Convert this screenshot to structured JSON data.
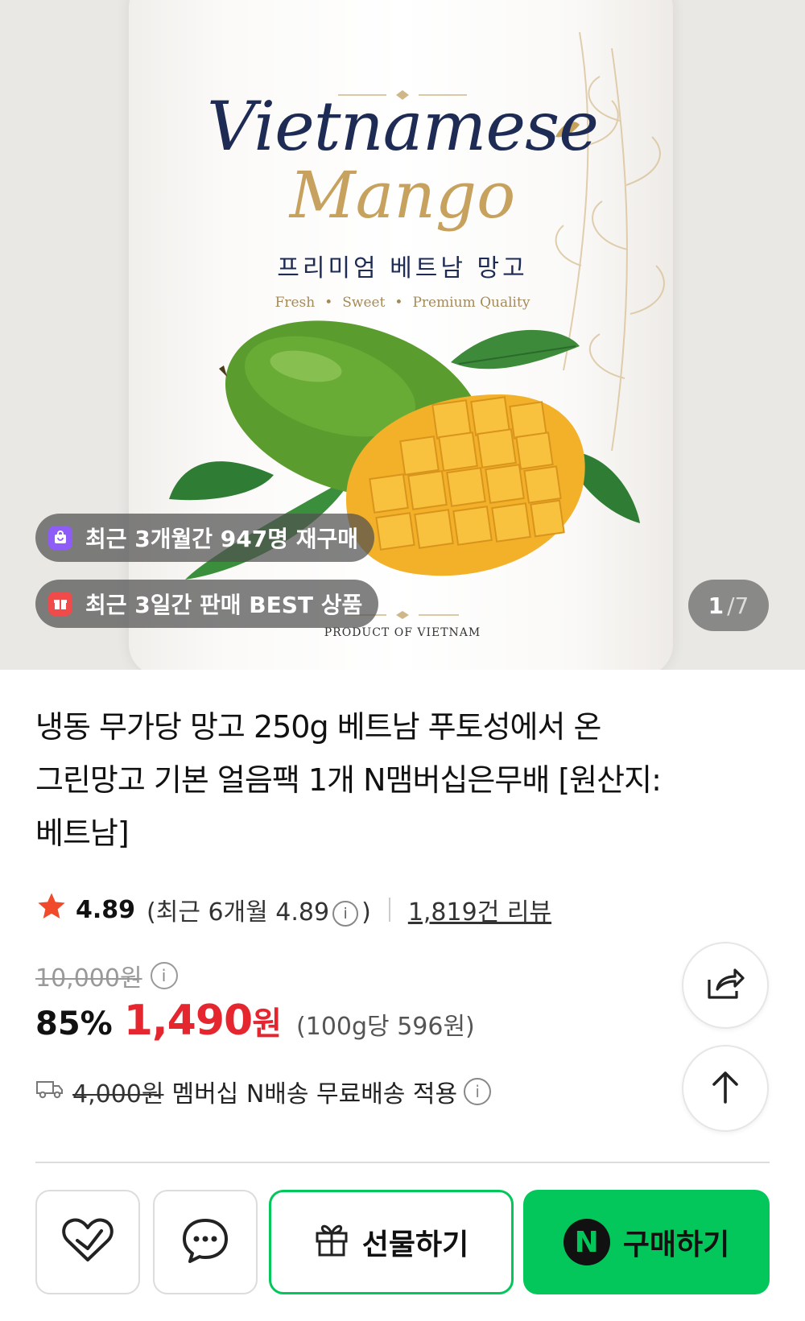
{
  "hero": {
    "brand_line1": "Vietnamese",
    "brand_line2": "Mango",
    "brand_korean": "프리미엄 베트남 망고",
    "tags": [
      "Fresh",
      "Sweet",
      "Premium Quality"
    ],
    "origin": "PRODUCT OF VIETNAM",
    "badge_repurchase": "최근 3개월간 947명 재구매",
    "badge_best": "최근 3일간 판매 BEST 상품",
    "image_index": "1",
    "image_total": "/7"
  },
  "product": {
    "title_lines": [
      "냉동 무가당 망고 250g 베트남 푸토성에서 온",
      "그린망고 기본 얼음팩 1개 N맴버십은무배 [원산지:",
      "베트남]"
    ],
    "rating": "4.89",
    "recent_rating_prefix": "(최근 6개월 4.89",
    "recent_rating_suffix": ")",
    "reviews": "1,819건 리뷰",
    "original_price": "10,000원",
    "discount": "85%",
    "price": "1,490",
    "price_unit": "원",
    "unit_price": "(100g당 596원)",
    "shipping_original": "4,000원",
    "shipping_text": "멤버십 N배송 무료배송 적용"
  },
  "actions": {
    "gift_label": "선물하기",
    "buy_label": "구매하기",
    "buy_badge": "N"
  },
  "colors": {
    "accent_green": "#03c75a",
    "price_red": "#e5262f",
    "brand_navy": "#1d2b55",
    "brand_gold": "#c6a25e"
  },
  "icons": [
    "heart-icon",
    "chat-icon",
    "gift-icon",
    "share-icon",
    "arrow-up-icon",
    "truck-icon",
    "star-icon",
    "bag-icon",
    "present-icon",
    "info-icon"
  ]
}
